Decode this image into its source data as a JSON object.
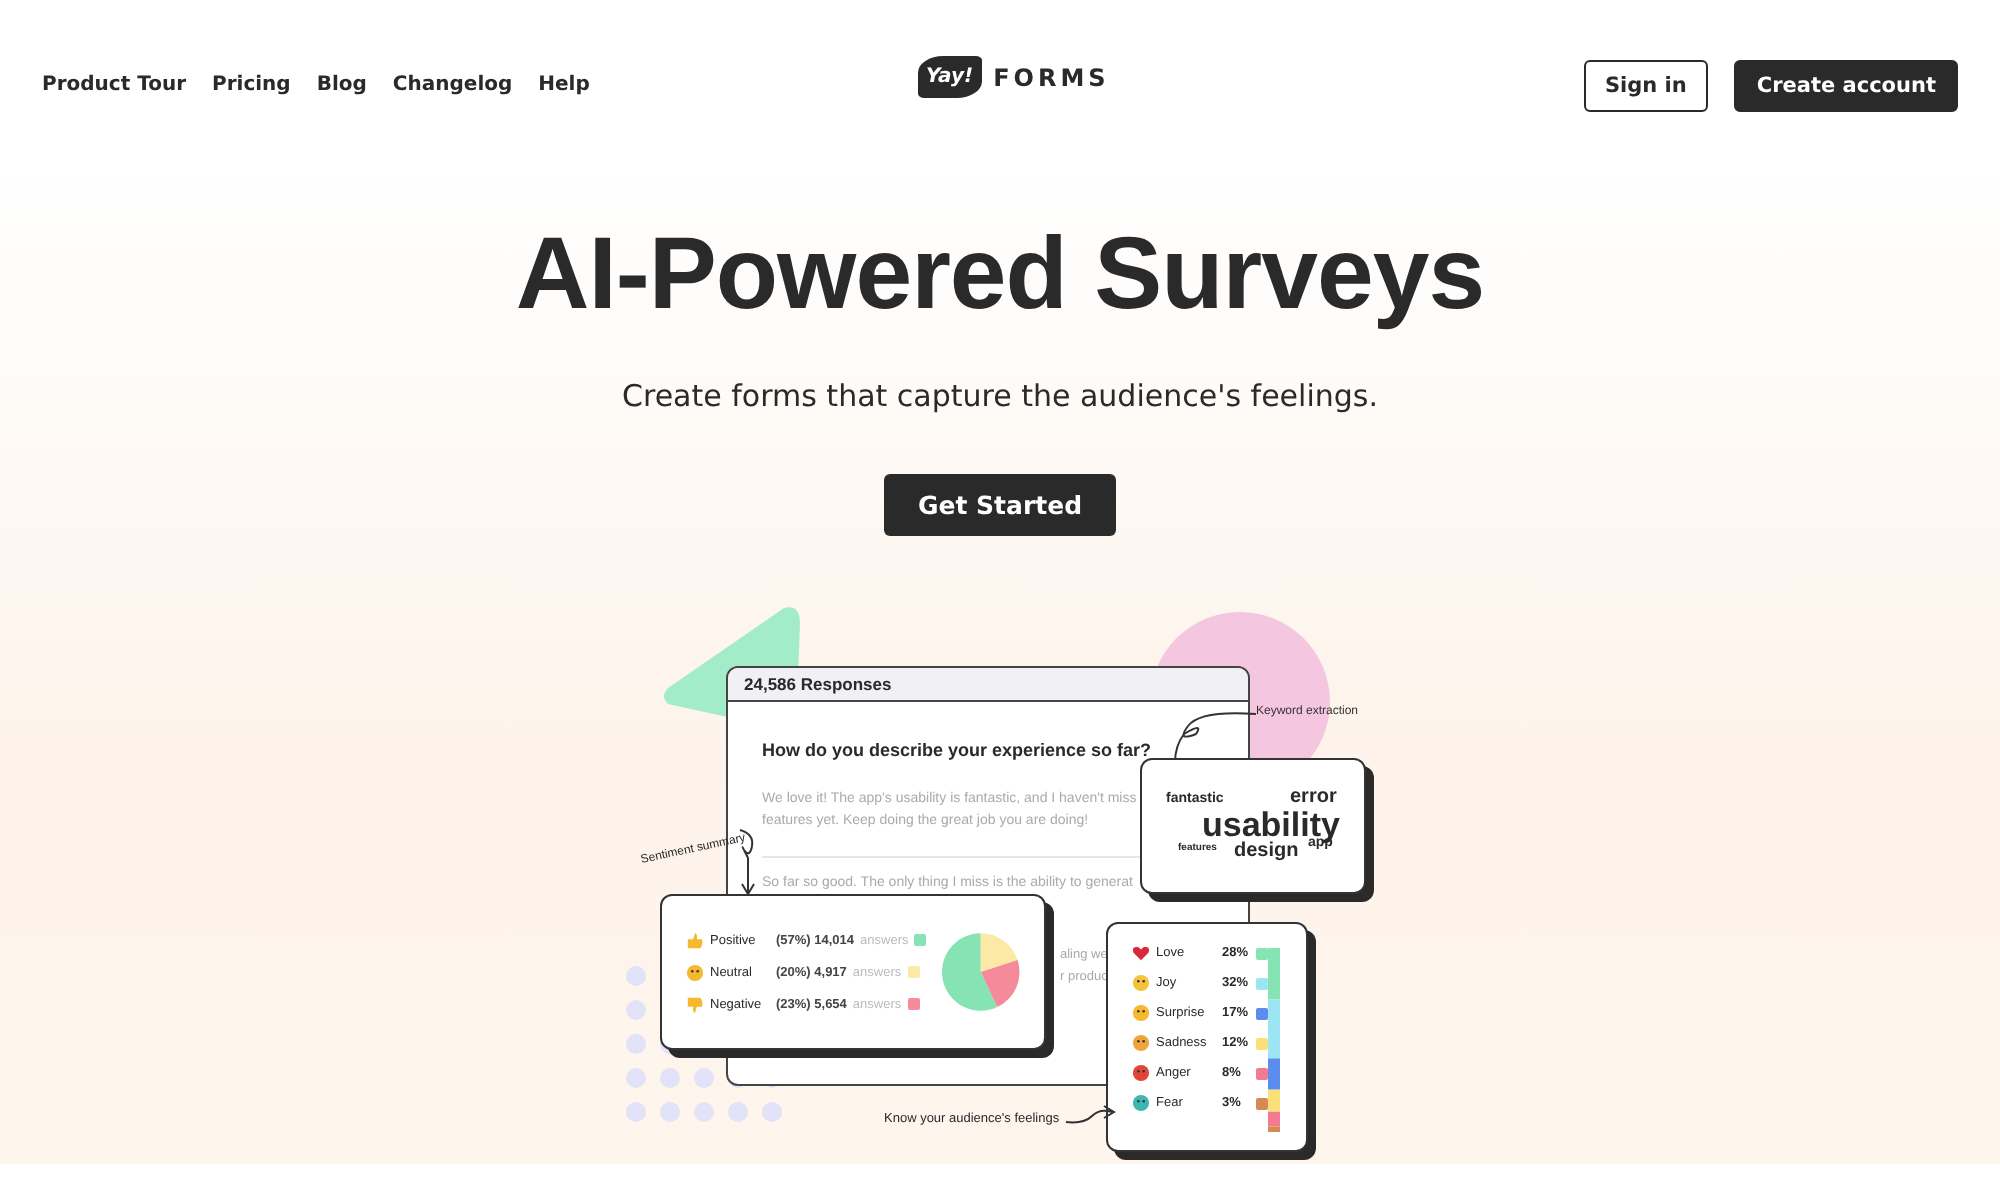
{
  "nav": {
    "links": [
      {
        "label": "Product Tour"
      },
      {
        "label": "Pricing"
      },
      {
        "label": "Blog"
      },
      {
        "label": "Changelog"
      },
      {
        "label": "Help"
      }
    ],
    "logo": {
      "mark": "Yay!",
      "text": "FORMS"
    },
    "buttons": [
      {
        "label": "Sign in",
        "kind": "outline"
      },
      {
        "label": "Create account",
        "kind": "solid"
      }
    ]
  },
  "hero": {
    "title": "AI-Powered Surveys",
    "subtitle": "Create forms that capture the audience's feelings.",
    "cta": "Get Started"
  },
  "illustration": {
    "responses": {
      "header": "24,586 Responses",
      "question": "How do you describe your experience so far?",
      "answers": [
        "We love it! The app's usability is fantastic, and I haven't miss",
        "features yet. Keep doing the great job you are doing!",
        "So far so good. The only thing I miss is the ability to generat"
      ],
      "hidden_fragments": [
        "aling we",
        "r produc"
      ]
    },
    "keywords": {
      "label": "Keyword extraction",
      "words": [
        {
          "text": "fantastic",
          "kind": "small"
        },
        {
          "text": "error",
          "kind": "medium"
        },
        {
          "text": "usability",
          "kind": "large"
        },
        {
          "text": "features",
          "kind": "tiny"
        },
        {
          "text": "design",
          "kind": "medium"
        },
        {
          "text": "app",
          "kind": "small"
        }
      ]
    },
    "sentiment": {
      "label": "Sentiment summary",
      "rows": [
        {
          "label": "Positive",
          "stat": "(57%) 14,014",
          "unit": "answers",
          "color": "#86e3b4",
          "kind": "thumbs-up"
        },
        {
          "label": "Neutral",
          "stat": "(20%) 4,917",
          "unit": "answers",
          "color": "#fbeaa6",
          "kind": "face"
        },
        {
          "label": "Negative",
          "stat": "(23%) 5,654",
          "unit": "answers",
          "color": "#f58a9b",
          "kind": "thumbs-down"
        }
      ],
      "chart_data": {
        "type": "pie",
        "values": [
          57,
          20,
          23
        ]
      }
    },
    "emotions": {
      "label": "Know your audience's feelings",
      "rows": [
        {
          "label": "Love",
          "pct": "28%",
          "color": "#86e3b4",
          "kind": "heart"
        },
        {
          "label": "Joy",
          "pct": "32%",
          "color": "#9be6f2",
          "kind": "smile"
        },
        {
          "label": "Surprise",
          "pct": "17%",
          "color": "#5b8def",
          "kind": "surprise"
        },
        {
          "label": "Sadness",
          "pct": "12%",
          "color": "#fbe07a",
          "kind": "sad"
        },
        {
          "label": "Anger",
          "pct": "8%",
          "color": "#f27a92",
          "kind": "anger"
        },
        {
          "label": "Fear",
          "pct": "3%",
          "color": "#d48a55",
          "kind": "fear"
        }
      ]
    }
  }
}
